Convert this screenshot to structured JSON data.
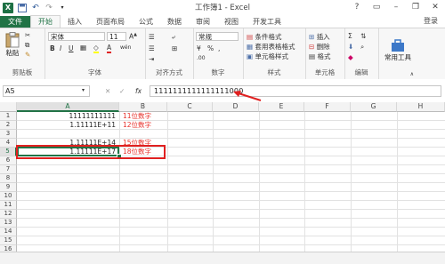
{
  "window": {
    "title": "工作簿1 - Excel",
    "login": "登录"
  },
  "tabs": [
    "文件",
    "开始",
    "插入",
    "页面布局",
    "公式",
    "数据",
    "审阅",
    "视图",
    "开发工具"
  ],
  "ribbon": {
    "clipboard": {
      "paste": "粘贴",
      "label": "剪贴板"
    },
    "font": {
      "name": "宋体",
      "size": "11",
      "label": "字体",
      "bold": "B",
      "italic": "I",
      "underline": "U",
      "wen": "wén"
    },
    "alignment": {
      "label": "对齐方式"
    },
    "number": {
      "format": "常规",
      "label": "数字",
      "percent": "%",
      "comma": ","
    },
    "styles": {
      "conditional": "条件格式",
      "table": "套用表格格式",
      "cell": "单元格样式",
      "label": "样式"
    },
    "cells": {
      "insert": "插入",
      "delete": "删除",
      "format": "格式",
      "label": "单元格"
    },
    "editing": {
      "label": "编辑"
    },
    "tools": {
      "common": "常用工具"
    }
  },
  "formula_bar": {
    "name_box": "A5",
    "fx": "fx",
    "value": "1111111111111111000"
  },
  "columns": [
    "A",
    "B",
    "C",
    "D",
    "E",
    "F",
    "G",
    "H"
  ],
  "rows": [
    "1",
    "2",
    "3",
    "4",
    "5",
    "6",
    "7",
    "8",
    "9",
    "10",
    "11",
    "12",
    "13",
    "14",
    "15",
    "16"
  ],
  "cells": {
    "A1": "11111111111",
    "A2": "1.11111E+11",
    "A4": "1.11111E+14",
    "A5": "1.11111E+17",
    "B1": "11位数字",
    "B2": "12位数字",
    "B4": "15位数字",
    "B5": "18位数字"
  },
  "colors": {
    "excel_green": "#217346",
    "highlight_red": "#e02020",
    "label_red": "#e8302a"
  }
}
